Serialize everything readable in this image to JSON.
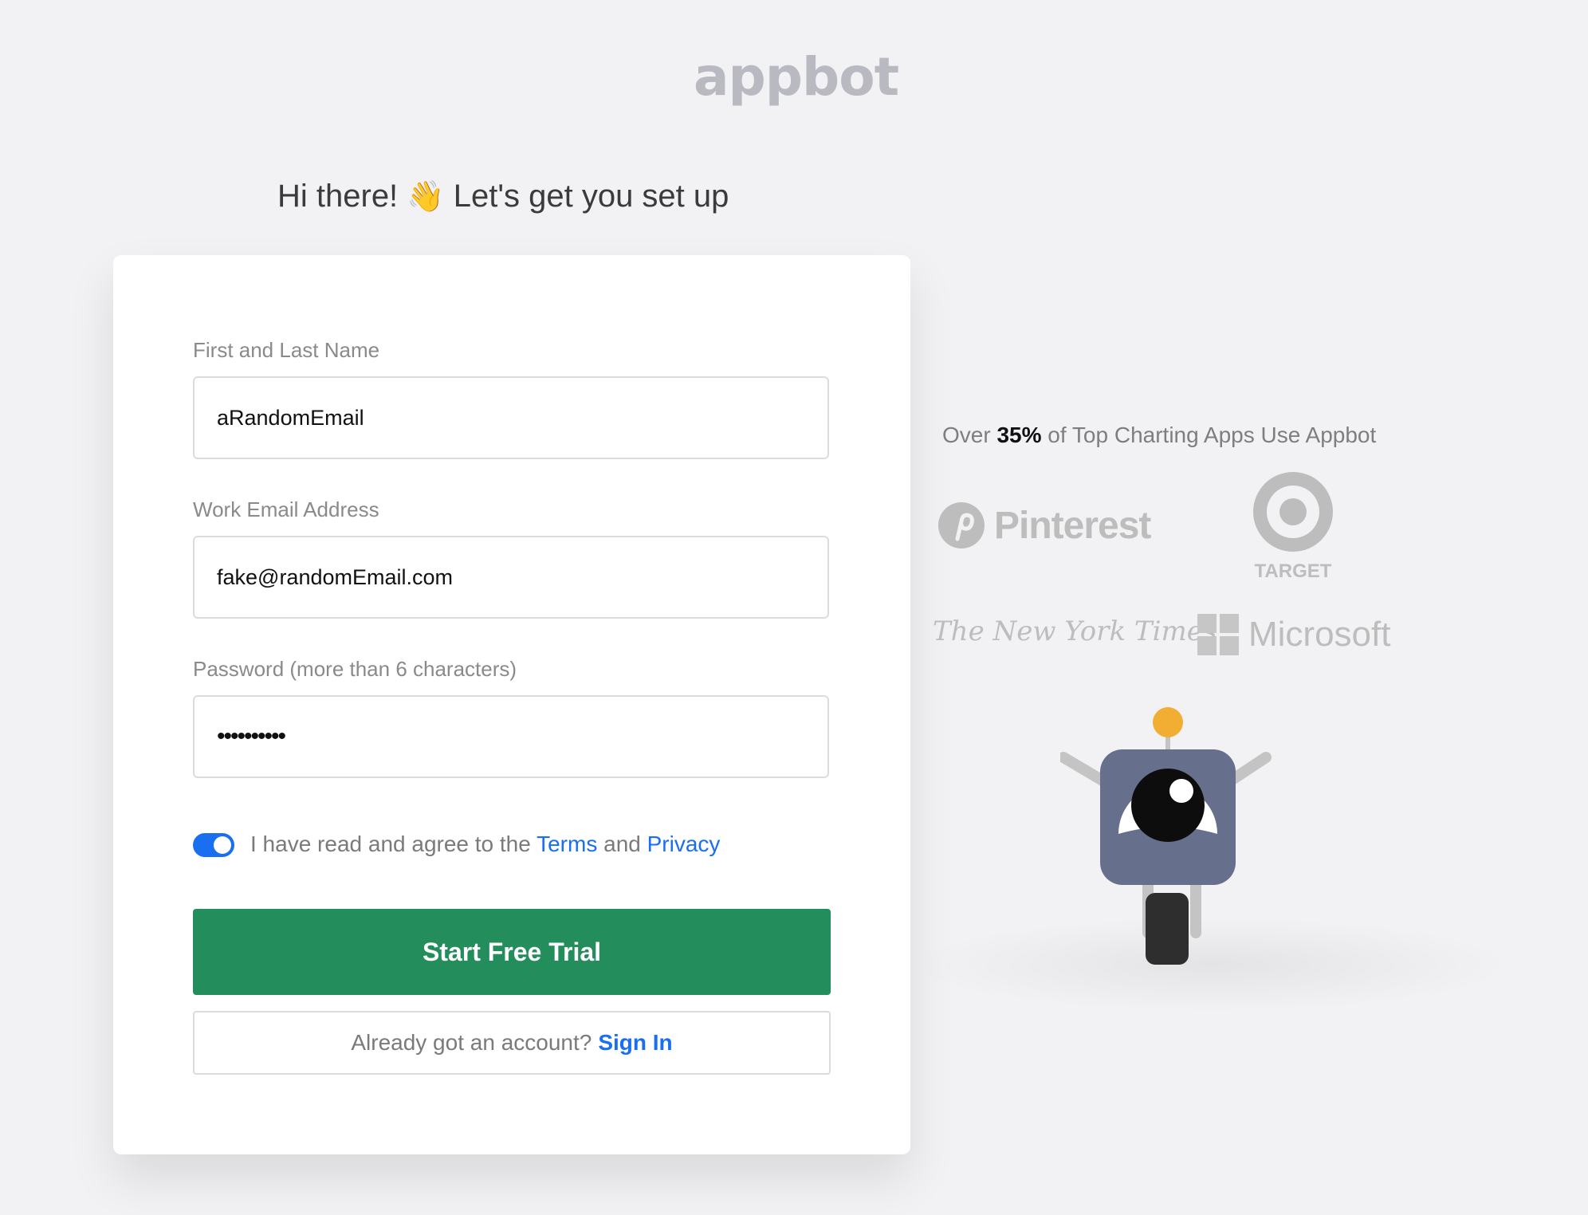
{
  "brand": {
    "logo": "appbot"
  },
  "header": {
    "greeting": "Hi there!",
    "subtitle": "Let's get you set up"
  },
  "form": {
    "name": {
      "label": "First and Last Name",
      "value": "aRandomEmail"
    },
    "email": {
      "label": "Work Email Address",
      "value": "fake@randomEmail.com"
    },
    "password": {
      "label": "Password (more than 6 characters)",
      "value": "••••••••••"
    },
    "agree": {
      "prefix": "I have read and agree to the",
      "terms": "Terms",
      "and": "and",
      "privacy": "Privacy",
      "checked": true
    },
    "submit_label": "Start Free Trial",
    "signin": {
      "prompt": "Already got an account?",
      "link": "Sign In"
    }
  },
  "social": {
    "prefix": "Over",
    "percent": "35%",
    "suffix": "of Top Charting Apps Use Appbot",
    "logos": [
      "Pinterest",
      "TARGET",
      "The New York Times",
      "Microsoft"
    ]
  },
  "colors": {
    "accent": "#1a6ff0",
    "cta": "#238e5c",
    "background": "#f2f2f4"
  },
  "icons": [
    "waving-hand-icon",
    "pinterest-logo",
    "target-logo",
    "nyt-logo",
    "microsoft-logo",
    "robot-mascot"
  ]
}
